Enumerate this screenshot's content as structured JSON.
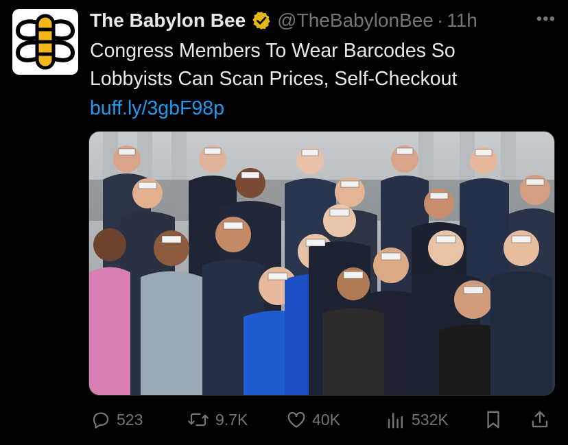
{
  "tweet": {
    "author_name": "The Babylon Bee",
    "handle": "@TheBabylonBee",
    "separator": "·",
    "timestamp": "11h",
    "text": "Congress Members To Wear Barcodes So Lobbyists Can Scan Prices, Self-Checkout",
    "link": "buff.ly/3gbF98p",
    "verified": true
  },
  "actions": {
    "replies": "523",
    "reposts": "9.7K",
    "likes": "40K",
    "views": "532K"
  },
  "icons": [
    "babylon-bee-logo-icon",
    "verified-badge-icon",
    "more-options-icon",
    "reply-icon",
    "repost-icon",
    "like-icon",
    "views-icon",
    "bookmark-icon",
    "share-icon"
  ],
  "colors": {
    "background": "#000000",
    "text": "#e7e9ea",
    "muted": "#71767b",
    "link": "#1d9bf0",
    "verified_gold": "#e2b719",
    "bee_yellow": "#f3b71b"
  }
}
